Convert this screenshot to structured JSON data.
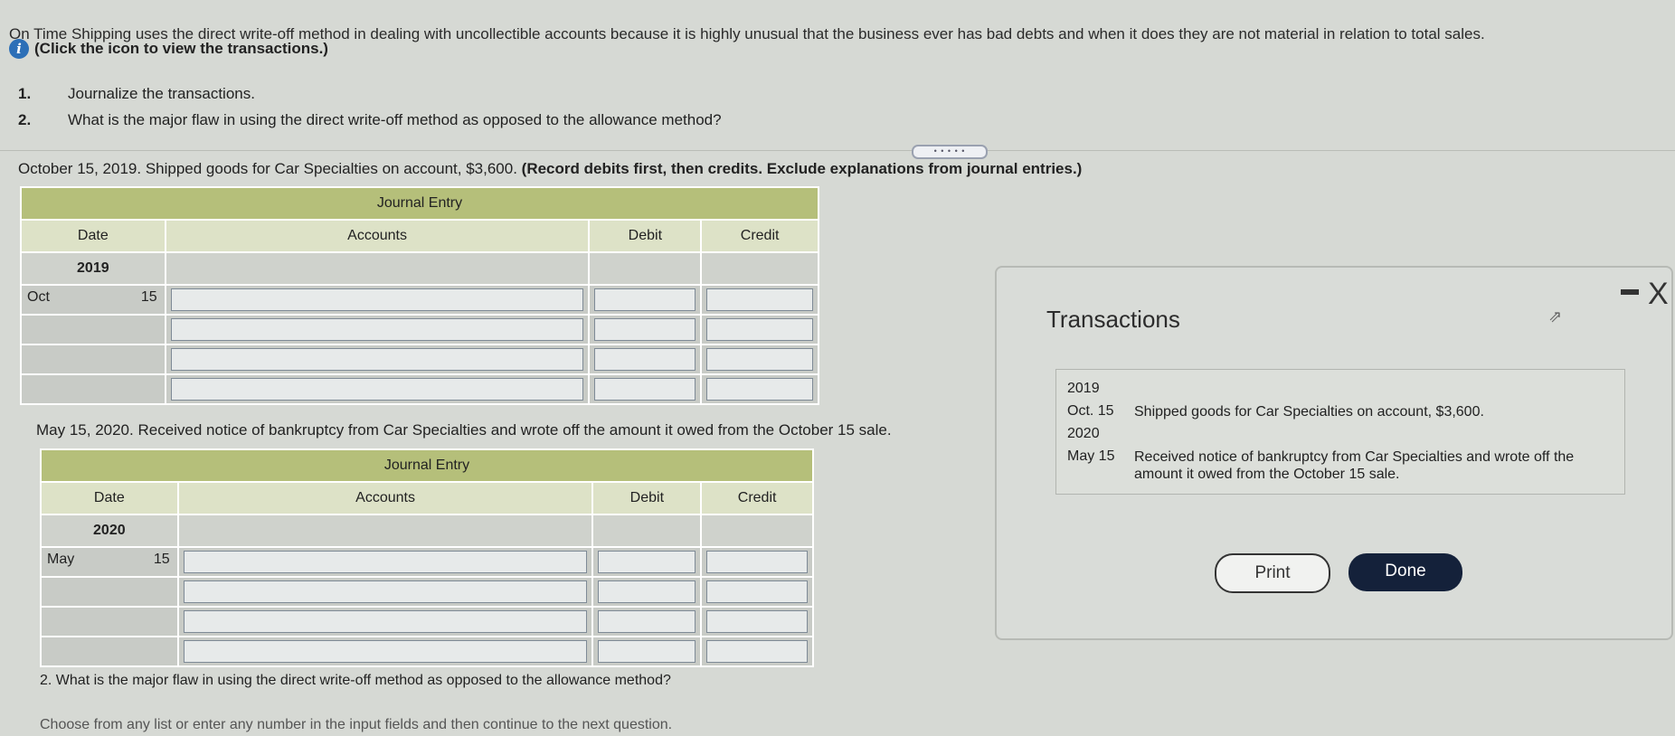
{
  "intro": "On Time Shipping uses the direct write-off method in dealing with uncollectible accounts because it is highly unusual that the business ever has bad debts and when it does they are not material in relation to total sales.",
  "info": {
    "icon": "i",
    "text": "(Click the icon to view the transactions.)"
  },
  "questions": [
    {
      "num": "1.",
      "text": "Journalize the transactions."
    },
    {
      "num": "2.",
      "text": "What is the major flaw in using the direct write-off method as opposed to the allowance method?"
    }
  ],
  "more_button": "• • • • •",
  "entry1": {
    "prompt": "October 15, 2019. Shipped goods for Car Specialties on account, $3,600.",
    "instruction": "(Record debits first, then credits. Exclude explanations from journal entries.)",
    "title": "Journal Entry",
    "headers": {
      "date": "Date",
      "accounts": "Accounts",
      "debit": "Debit",
      "credit": "Credit"
    },
    "year": "2019",
    "month": "Oct",
    "day": "15"
  },
  "entry2": {
    "prompt": "May 15, 2020. Received notice of bankruptcy from Car Specialties and wrote off the amount it owed from the October 15 sale.",
    "title": "Journal Entry",
    "headers": {
      "date": "Date",
      "accounts": "Accounts",
      "debit": "Debit",
      "credit": "Credit"
    },
    "year": "2020",
    "month": "May",
    "day": "15"
  },
  "modal": {
    "title": "Transactions",
    "year1": "2019",
    "tx1_date": "Oct. 15",
    "tx1_desc": "Shipped goods for Car Specialties on account, $3,600.",
    "year2": "2020",
    "tx2_date": "May 15",
    "tx2_desc": "Received notice of bankruptcy from Car Specialties and wrote off the amount it owed from the October 15 sale.",
    "print": "Print",
    "done": "Done",
    "close": "X"
  },
  "bottom_question": "2. What is the major flaw in using the direct write-off method as opposed to the allowance method?",
  "bottom_note": "Choose from any list or enter any number in the input fields and then continue to the next question."
}
